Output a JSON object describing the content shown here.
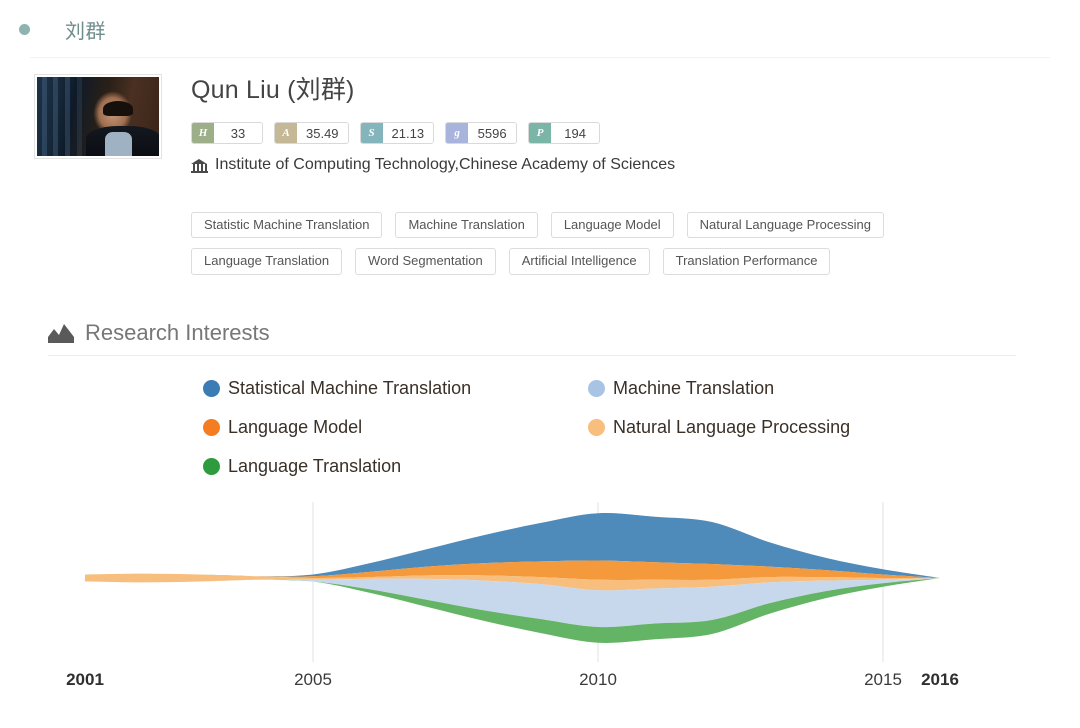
{
  "breadcrumb": {
    "label": "刘群",
    "dot_color": "#8FB3B0"
  },
  "profile": {
    "name": "Qun Liu (刘群)",
    "affiliation": "Institute of Computing Technology,Chinese Academy of Sciences",
    "avatar_alt": "portrait-photo",
    "stats": [
      {
        "key": "H",
        "value": "33",
        "color": "#9CAF88"
      },
      {
        "key": "A",
        "value": "35.49",
        "color": "#C4B896"
      },
      {
        "key": "S",
        "value": "21.13",
        "color": "#84B4BC"
      },
      {
        "key": "G",
        "value": "5596",
        "color": "#A8B4DC"
      },
      {
        "key": "P",
        "value": "194",
        "color": "#7BB5A8"
      }
    ],
    "tags": [
      "Statistic Machine Translation",
      "Machine Translation",
      "Language Model",
      "Natural Language Processing",
      "Language Translation",
      "Word Segmentation",
      "Artificial Intelligence",
      "Translation Performance"
    ]
  },
  "research_interests": {
    "section_title": "Research Interests",
    "section_icon": "area-chart-icon"
  },
  "chart_data": {
    "type": "area",
    "title": "Research Interests",
    "xlabel": "",
    "ylabel": "",
    "xlim": [
      2001,
      2016
    ],
    "grid": true,
    "gridlines_at": [
      2005,
      2010,
      2015
    ],
    "legend_position": "top",
    "tick_labels": [
      "2001",
      "2005",
      "2010",
      "2015",
      "2016"
    ],
    "bold_ticks": [
      "2001",
      "2016"
    ],
    "stacking": "streamgraph-wiggle",
    "x": [
      2001,
      2002,
      2003,
      2004,
      2005,
      2006,
      2007,
      2008,
      2009,
      2010,
      2011,
      2012,
      2013,
      2014,
      2015,
      2016
    ],
    "series": [
      {
        "name": "Statistical Machine Translation",
        "color": "#4E8ABA",
        "values": [
          0,
          0,
          0,
          0,
          1,
          5,
          10,
          16,
          22,
          27,
          26,
          24,
          14,
          7,
          3,
          0
        ]
      },
      {
        "name": "Machine Translation",
        "color": "#C8D8EC",
        "values": [
          0,
          0,
          0,
          0,
          1,
          6,
          12,
          17,
          20,
          21,
          20,
          19,
          12,
          6,
          2,
          0
        ]
      },
      {
        "name": "Language Model",
        "color": "#F59A3C",
        "values": [
          0,
          0,
          0,
          0,
          1,
          3,
          5,
          7,
          9,
          11,
          10,
          9,
          6,
          4,
          2,
          0
        ]
      },
      {
        "name": "Natural Language Processing",
        "color": "#F8BE7E",
        "values": [
          4,
          5,
          4,
          2,
          1,
          1,
          2,
          3,
          4,
          6,
          5,
          4,
          3,
          2,
          1,
          0
        ]
      },
      {
        "name": "Language Translation",
        "color": "#63B464",
        "values": [
          0,
          0,
          0,
          0,
          0,
          2,
          4,
          6,
          8,
          9,
          9,
          8,
          6,
          4,
          2,
          0
        ]
      }
    ]
  }
}
